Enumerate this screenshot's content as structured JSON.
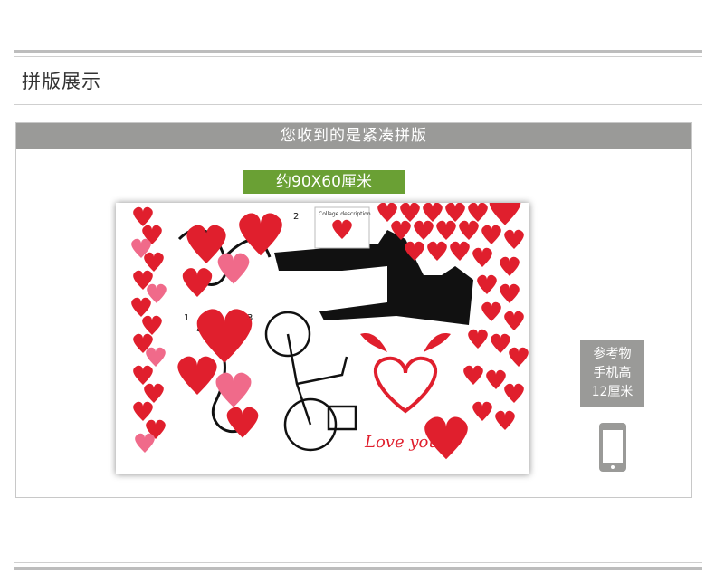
{
  "section_title": "拼版展示",
  "panel_header": "您收到的是紧凑拼版",
  "size_badge": "约90X60厘米",
  "sticker": {
    "love_text": "Love you",
    "collage_label": "Collage description",
    "part_numbers": [
      "2",
      "1",
      "3"
    ]
  },
  "reference": {
    "line1": "参考物",
    "line2": "手机高",
    "line3": "12厘米"
  },
  "icons": [
    "phone-icon",
    "heart-icon",
    "bicycle-icon",
    "bird-icon"
  ],
  "colors": {
    "header_gray": "#9a9a98",
    "badge_green": "#6aa034",
    "heart_red": "#e01f2d"
  }
}
